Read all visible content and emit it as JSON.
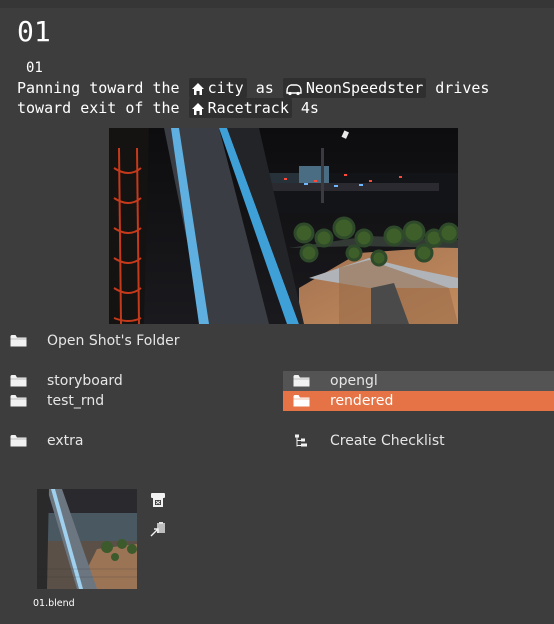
{
  "shot": {
    "title": "01",
    "subtitle": "01",
    "line1_pre": "Panning toward the ",
    "place1": "city",
    "line1_mid": " as ",
    "vehicle": "NeonSpeedster",
    "line1_post": " drives",
    "line2_pre": "toward exit of the ",
    "place2": "Racetrack",
    "line2_post": " 4s"
  },
  "actions": {
    "open_folder": "Open Shot's Folder",
    "create_checklist": "Create Checklist"
  },
  "folders": {
    "storyboard": "storyboard",
    "test_rnd": "test_rnd",
    "extra": "extra",
    "opengl": "opengl",
    "rendered": "rendered"
  },
  "file": {
    "name": "01.blend"
  },
  "icons": {
    "home": "home-icon",
    "car": "car-icon",
    "folder": "folder-icon",
    "checklist": "checklist-icon",
    "render": "render-icon",
    "link": "link-icon"
  },
  "colors": {
    "accent": "#e57345",
    "background": "#3d3d3d",
    "hover": "#545454"
  }
}
